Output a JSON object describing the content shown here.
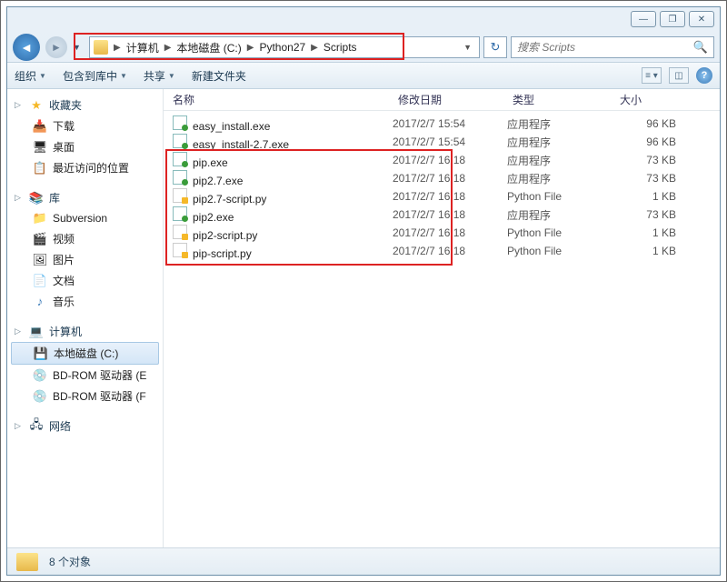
{
  "window_controls": {
    "min": "—",
    "max": "❐",
    "close": "✕"
  },
  "breadcrumb": {
    "items": [
      "计算机",
      "本地磁盘 (C:)",
      "Python27",
      "Scripts"
    ]
  },
  "search": {
    "placeholder": "搜索 Scripts"
  },
  "toolbar": {
    "organize": "组织",
    "include": "包含到库中",
    "share": "共享",
    "newfolder": "新建文件夹"
  },
  "sidebar": {
    "favorites": {
      "label": "收藏夹",
      "items": [
        "下载",
        "桌面",
        "最近访问的位置"
      ]
    },
    "libraries": {
      "label": "库",
      "items": [
        "Subversion",
        "视频",
        "图片",
        "文档",
        "音乐"
      ]
    },
    "computer": {
      "label": "计算机",
      "items": [
        "本地磁盘 (C:)",
        "BD-ROM 驱动器 (E",
        "BD-ROM 驱动器 (F"
      ]
    },
    "network": {
      "label": "网络"
    }
  },
  "columns": {
    "name": "名称",
    "date": "修改日期",
    "type": "类型",
    "size": "大小"
  },
  "files": [
    {
      "icon": "exe",
      "name": "easy_install.exe",
      "date": "2017/2/7 15:54",
      "type": "应用程序",
      "size": "96 KB"
    },
    {
      "icon": "exe",
      "name": "easy_install-2.7.exe",
      "date": "2017/2/7 15:54",
      "type": "应用程序",
      "size": "96 KB"
    },
    {
      "icon": "exe",
      "name": "pip.exe",
      "date": "2017/2/7 16:18",
      "type": "应用程序",
      "size": "73 KB"
    },
    {
      "icon": "exe",
      "name": "pip2.7.exe",
      "date": "2017/2/7 16:18",
      "type": "应用程序",
      "size": "73 KB"
    },
    {
      "icon": "py",
      "name": "pip2.7-script.py",
      "date": "2017/2/7 16:18",
      "type": "Python File",
      "size": "1 KB"
    },
    {
      "icon": "exe",
      "name": "pip2.exe",
      "date": "2017/2/7 16:18",
      "type": "应用程序",
      "size": "73 KB"
    },
    {
      "icon": "py",
      "name": "pip2-script.py",
      "date": "2017/2/7 16:18",
      "type": "Python File",
      "size": "1 KB"
    },
    {
      "icon": "py",
      "name": "pip-script.py",
      "date": "2017/2/7 16:18",
      "type": "Python File",
      "size": "1 KB"
    }
  ],
  "status": {
    "count": "8 个对象"
  }
}
